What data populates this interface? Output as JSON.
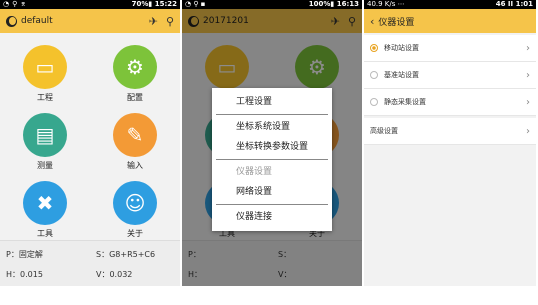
{
  "screen1": {
    "status": {
      "left_icons": [
        "◔",
        "⚲",
        "⌆",
        "▪"
      ],
      "right": "70%▮ 15:22"
    },
    "appbar": {
      "title": "default",
      "icon1": "satellite-icon",
      "icon2": "station-icon"
    },
    "tiles": [
      {
        "label": "工程",
        "icon": "folder-icon",
        "color": "#f4c22c"
      },
      {
        "label": "配置",
        "icon": "gear-icon",
        "color": "#7dc33a"
      },
      {
        "label": "测量",
        "icon": "ruler-icon",
        "color": "#37a78e"
      },
      {
        "label": "输入",
        "icon": "edit-icon",
        "color": "#f39a36"
      },
      {
        "label": "工具",
        "icon": "tools-icon",
        "color": "#2e9ee1"
      },
      {
        "label": "关于",
        "icon": "robot-icon",
        "color": "#2e9ee1"
      }
    ],
    "info": {
      "p": "P：固定解",
      "s": "S：G8+R5+C6",
      "h": "H：0.015",
      "v": "V：0.032"
    }
  },
  "screen2": {
    "status": {
      "right": "100%▮ 16:13"
    },
    "appbar": {
      "title": "20171201"
    },
    "menu": [
      {
        "label": "工程设置",
        "disabled": false
      },
      {
        "label": "坐标系统设置",
        "disabled": false
      },
      {
        "label": "坐标转换参数设置",
        "disabled": false
      },
      {
        "label": "仪器设置",
        "disabled": true
      },
      {
        "label": "网络设置",
        "disabled": false
      },
      {
        "label": "仪器连接",
        "disabled": false
      }
    ],
    "info": {
      "p": "P：",
      "s": "S：",
      "h": "H：",
      "v": "V："
    }
  },
  "screen3": {
    "status": {
      "left": "40.9 K/s ⋯",
      "right": "46 ⅠⅠ 1:01"
    },
    "appbar": {
      "title": "仪器设置"
    },
    "items": [
      {
        "label": "移动站设置",
        "selected": true
      },
      {
        "label": "基准站设置",
        "selected": false
      },
      {
        "label": "静态采集设置",
        "selected": false
      },
      {
        "label": "高级设置",
        "selected": null
      }
    ]
  }
}
